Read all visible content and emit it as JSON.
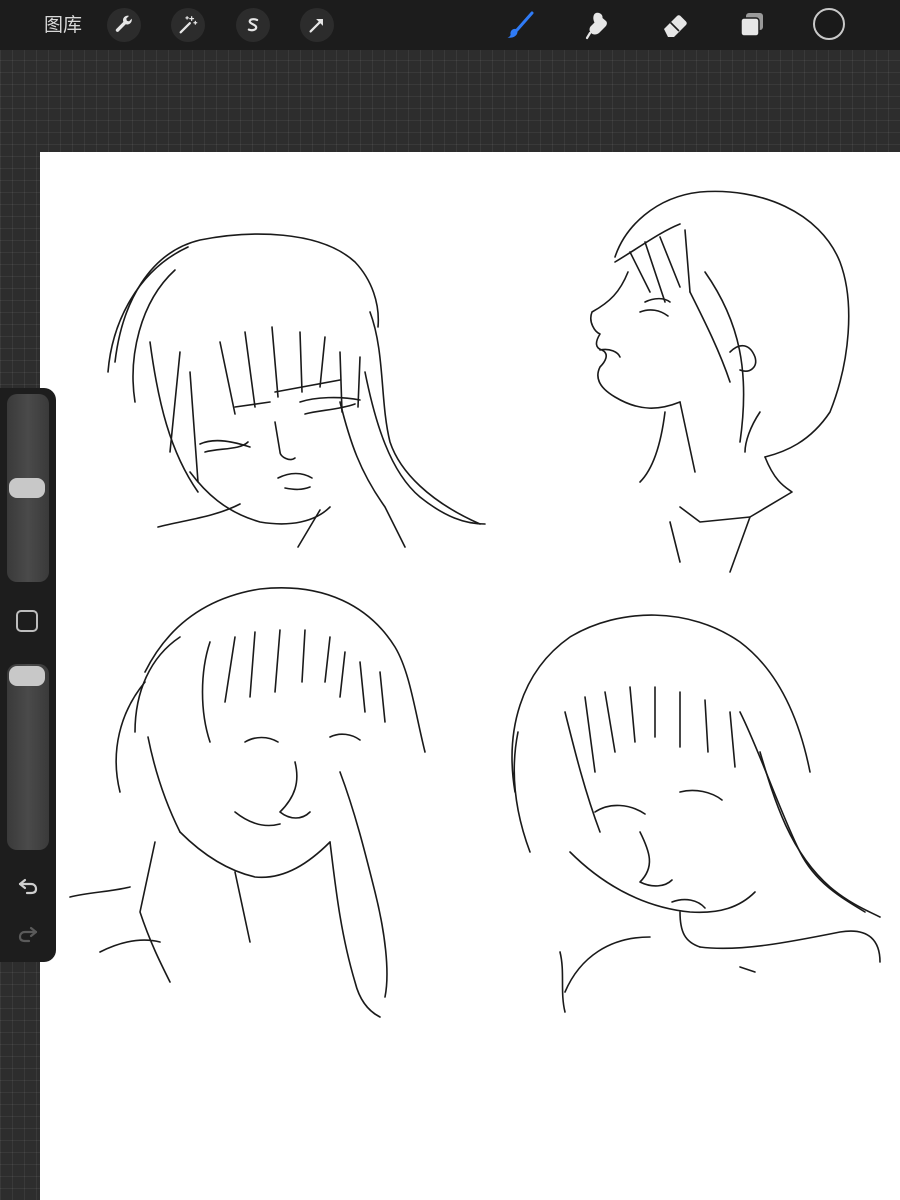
{
  "toolbar": {
    "gallery_label": "图库",
    "left_tools": [
      "wrench-icon",
      "magic-wand-icon",
      "selection-s-icon",
      "transform-arrow-icon"
    ],
    "right_tools": [
      "brush-icon",
      "smudge-icon",
      "eraser-icon",
      "layers-icon"
    ],
    "active_tool": "brush-icon",
    "active_color": "#1a1a1a",
    "accent_color": "#2f7bf6"
  },
  "sidebar": {
    "brush_size_level": 0.5,
    "opacity_level": 0.0,
    "modify_button": "square-icon",
    "undo": "undo-icon",
    "redo": "redo-icon"
  },
  "canvas": {
    "background": "#ffffff",
    "content": "four-sketched-heads"
  }
}
